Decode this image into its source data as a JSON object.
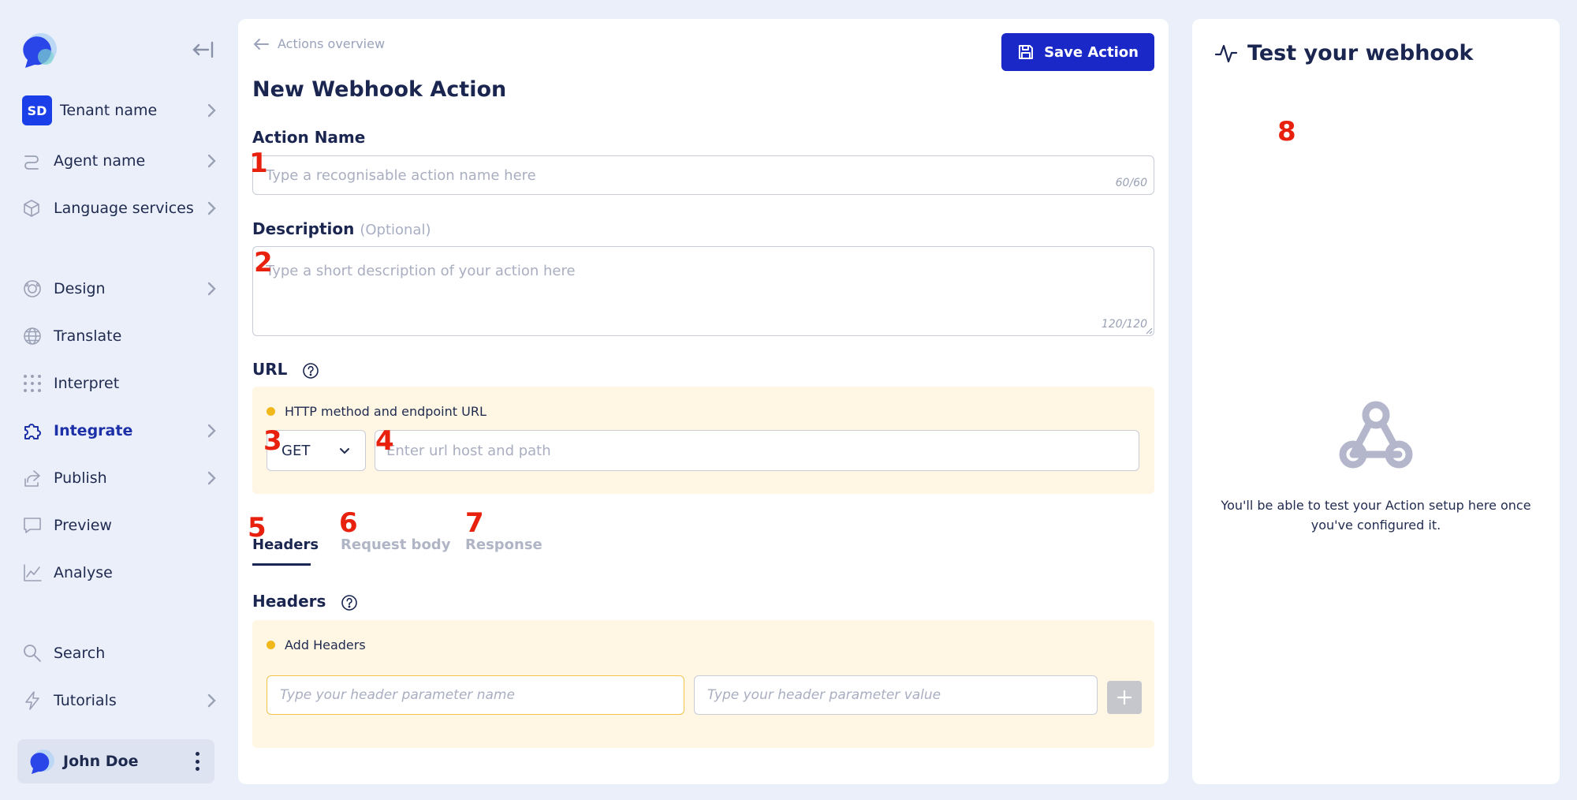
{
  "sidebar": {
    "collapse_icon": "collapse-left-icon",
    "items": [
      {
        "label": "Tenant name",
        "icon": "tenant-badge",
        "badge": "SD",
        "chevron": true
      },
      {
        "label": "Agent name",
        "icon": "agent-route-icon",
        "chevron": true
      },
      {
        "label": "Language services",
        "icon": "cube-icon",
        "chevron": true
      },
      {
        "label": "Design",
        "icon": "design-icon",
        "chevron": true
      },
      {
        "label": "Translate",
        "icon": "globe-icon",
        "chevron": false
      },
      {
        "label": "Interpret",
        "icon": "dots-grid-icon",
        "chevron": false
      },
      {
        "label": "Integrate",
        "icon": "puzzle-icon",
        "chevron": true,
        "active": true
      },
      {
        "label": "Publish",
        "icon": "share-icon",
        "chevron": true
      },
      {
        "label": "Preview",
        "icon": "chat-preview-icon",
        "chevron": false
      },
      {
        "label": "Analyse",
        "icon": "chart-icon",
        "chevron": false
      },
      {
        "label": "Search",
        "icon": "search-icon",
        "chevron": false
      },
      {
        "label": "Tutorials",
        "icon": "lightning-icon",
        "chevron": true
      }
    ],
    "user": {
      "name": "John Doe"
    }
  },
  "main": {
    "back_label": "Actions overview",
    "save_label": "Save Action",
    "title": "New Webhook Action",
    "action_name": {
      "label": "Action Name",
      "placeholder": "Type a recognisable action name here",
      "counter": "60/60"
    },
    "description": {
      "label": "Description",
      "optional": "(Optional)",
      "placeholder": "Type a short description of your action here",
      "counter": "120/120"
    },
    "url": {
      "label": "URL",
      "warning": "HTTP method and endpoint URL",
      "method": "GET",
      "placeholder": "Enter url host and path"
    },
    "tabs": [
      {
        "label": "Headers",
        "active": true
      },
      {
        "label": "Request body",
        "active": false
      },
      {
        "label": "Response",
        "active": false
      }
    ],
    "headers": {
      "label": "Headers",
      "warning": "Add Headers",
      "name_placeholder": "Type your header parameter name",
      "value_placeholder": "Type your header parameter value"
    }
  },
  "test_panel": {
    "title": "Test your webhook",
    "message": "You'll be able to test your Action setup here once you've configured it."
  },
  "markers": [
    "1",
    "2",
    "3",
    "4",
    "5",
    "6",
    "7",
    "8"
  ],
  "colors": {
    "accent": "#1a28c8",
    "active_nav": "#1d30a8",
    "warning_bg": "#fff6e3",
    "warning_dot": "#f1b81b",
    "marker_red": "#e8210e"
  }
}
